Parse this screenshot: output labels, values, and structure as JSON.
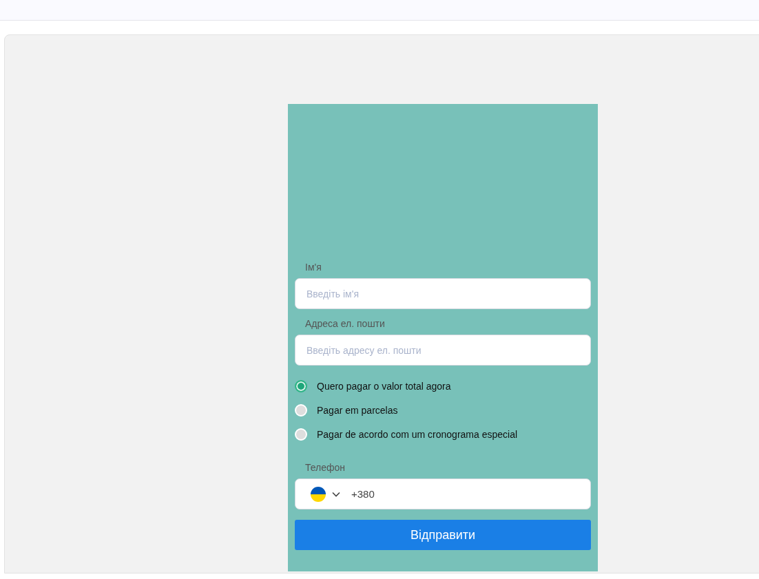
{
  "form": {
    "fields": [
      {
        "label": "Ім'я",
        "placeholder": "Введіть ім'я"
      },
      {
        "label": "Адреса ел. пошти",
        "placeholder": "Введіть адресу ел. пошти"
      }
    ],
    "payment_options": [
      {
        "label": "Quero pagar o valor total agora",
        "selected": true
      },
      {
        "label": "Pagar em parcelas",
        "selected": false
      },
      {
        "label": "Pagar de acordo com um cronograma especial",
        "selected": false
      }
    ],
    "phone": {
      "label": "Телефон",
      "value": "+380"
    },
    "submit": "Відправити"
  }
}
